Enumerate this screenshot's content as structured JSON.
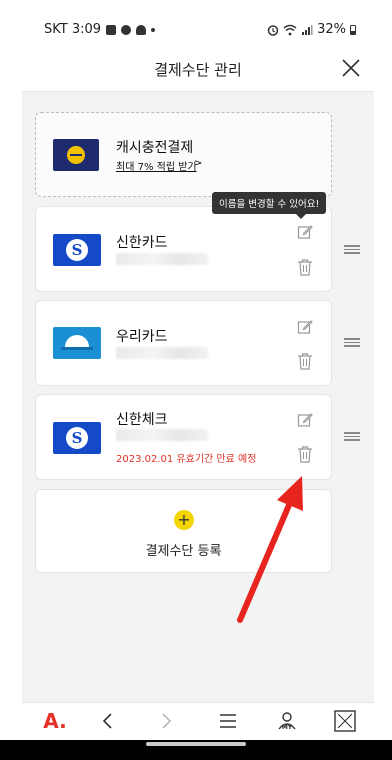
{
  "status_bar": {
    "carrier_time": "SKT 3:09",
    "battery": "32%"
  },
  "header": {
    "title": "결제수단 관리"
  },
  "cards": [
    {
      "name": "캐시충전결제",
      "link": "최대 7% 적립 받기",
      "link_arrow": ">",
      "logo_icon": "cash-coin-icon",
      "style": "dashed"
    },
    {
      "name": "신한카드",
      "logo_icon": "shinhan-logo-icon",
      "masked": true
    },
    {
      "name": "우리카드",
      "logo_icon": "woori-logo-icon",
      "masked": true
    },
    {
      "name": "신한체크",
      "logo_icon": "shinhan-logo-icon",
      "masked": true,
      "notice": "2023.02.01 유효기간 만료 예정"
    }
  ],
  "tooltip": "이름을 변경할 수 있어요!",
  "add_payment": {
    "plus": "+",
    "label": "결제수단 등록"
  },
  "bottom_bar": {
    "brand": "A.",
    "my_label": "MY"
  },
  "colors": {
    "brand_red": "#e53027",
    "annotation_red": "#e8241f",
    "shinhan_blue": "#1449c8",
    "woori_blue": "#1b8fd4",
    "cash_navy": "#1e2b6e",
    "accent_yellow": "#f5d400",
    "expire_red": "#e0342b"
  }
}
